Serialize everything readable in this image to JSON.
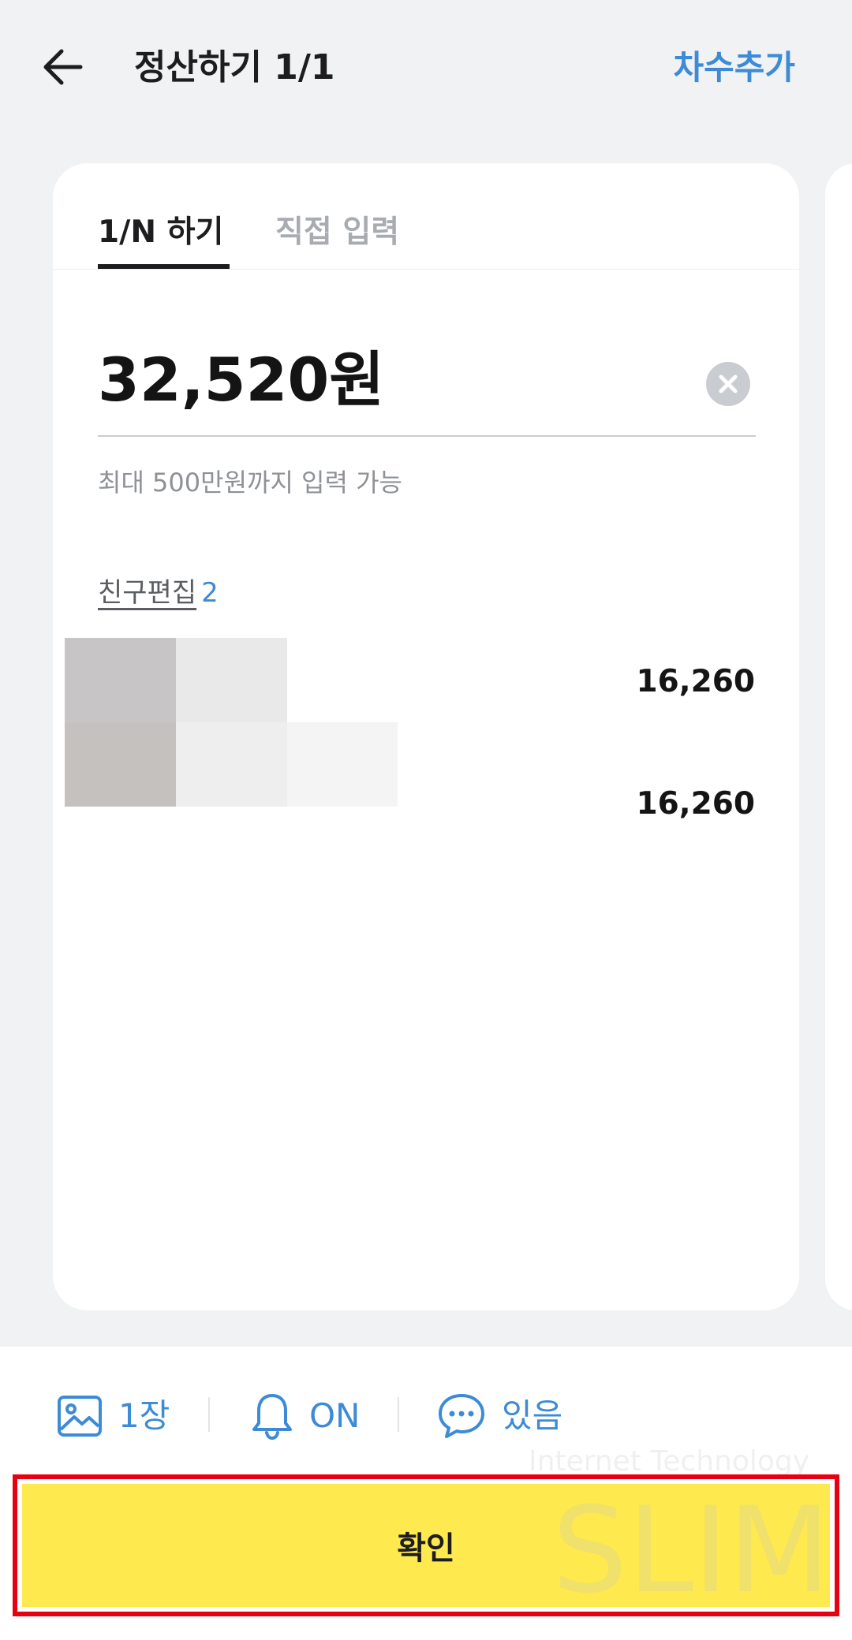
{
  "header": {
    "title": "정산하기 1/1",
    "add_round_label": "차수추가"
  },
  "tabs": [
    {
      "label": "1/N 하기",
      "active": true
    },
    {
      "label": "직접 입력",
      "active": false
    }
  ],
  "amount": {
    "value": "32,520원",
    "hint": "최대 500만원까지 입력 가능"
  },
  "friends": {
    "edit_label": "친구편집",
    "count": "2",
    "rows": [
      {
        "amount": "16,260"
      },
      {
        "amount": "16,260"
      }
    ]
  },
  "options": [
    {
      "icon": "image-icon",
      "label": "1장"
    },
    {
      "icon": "bell-icon",
      "label": "ON"
    },
    {
      "icon": "chat-bubble-icon",
      "label": "있음"
    }
  ],
  "watermark": {
    "line1": "Internet Technology",
    "line2": "SLIM"
  },
  "confirm_label": "확인",
  "colors": {
    "accent": "#3d8bd6",
    "confirm_bg": "#fee94e",
    "highlight_border": "#e60012"
  }
}
